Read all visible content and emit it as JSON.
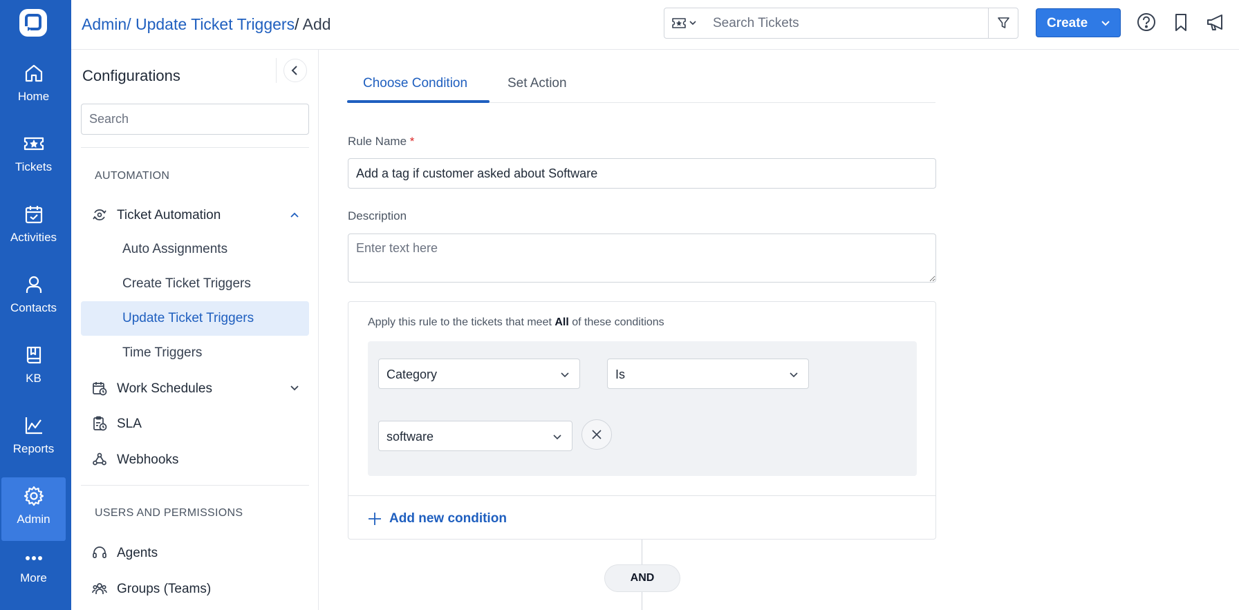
{
  "rail": {
    "items": [
      {
        "label": "Home",
        "icon": "home-icon"
      },
      {
        "label": "Tickets",
        "icon": "ticket-icon"
      },
      {
        "label": "Activities",
        "icon": "calendar-icon"
      },
      {
        "label": "Contacts",
        "icon": "person-icon"
      },
      {
        "label": "KB",
        "icon": "book-icon"
      },
      {
        "label": "Reports",
        "icon": "chart-icon"
      },
      {
        "label": "Admin",
        "icon": "gear-icon"
      },
      {
        "label": "More",
        "icon": "more-icon"
      }
    ],
    "active": "Admin",
    "bg_color": "#1f5fbf",
    "active_color": "#3a7be0"
  },
  "header": {
    "breadcrumb": {
      "admin": "Admin",
      "sep1": "/ ",
      "update": "Update Ticket Triggers",
      "sep2": "/ ",
      "current": "Add"
    },
    "search_placeholder": "Search Tickets",
    "create_label": "Create"
  },
  "config": {
    "title": "Configurations",
    "search_placeholder": "Search",
    "automation_section": "AUTOMATION",
    "ticket_automation": "Ticket Automation",
    "sub_items": [
      "Auto Assignments",
      "Create Ticket Triggers",
      "Update Ticket Triggers",
      "Time Triggers"
    ],
    "active_sub_item": "Update Ticket Triggers",
    "work_schedules": "Work Schedules",
    "sla": "SLA",
    "webhooks": "Webhooks",
    "users_section": "USERS AND PERMISSIONS",
    "agents": "Agents",
    "groups": "Groups (Teams)"
  },
  "main": {
    "tabs": [
      "Choose Condition",
      "Set Action"
    ],
    "active_tab": "Choose Condition",
    "rule_name_label": "Rule Name",
    "required_mark": "*",
    "rule_name_value": "Add a tag if customer asked about Software",
    "description_label": "Description",
    "description_placeholder": "Enter text here",
    "conditions": {
      "intro_before": "Apply this rule to the tickets that meet ",
      "intro_bold": "All",
      "intro_after": " of these conditions",
      "field": "Category",
      "operator": "Is",
      "value": "software",
      "add_label": "Add new condition"
    },
    "and_label": "AND"
  },
  "colors": {
    "accent": "#1f5fbf",
    "button": "#2f7ae5",
    "active_nav_bg": "#e3edfb"
  }
}
